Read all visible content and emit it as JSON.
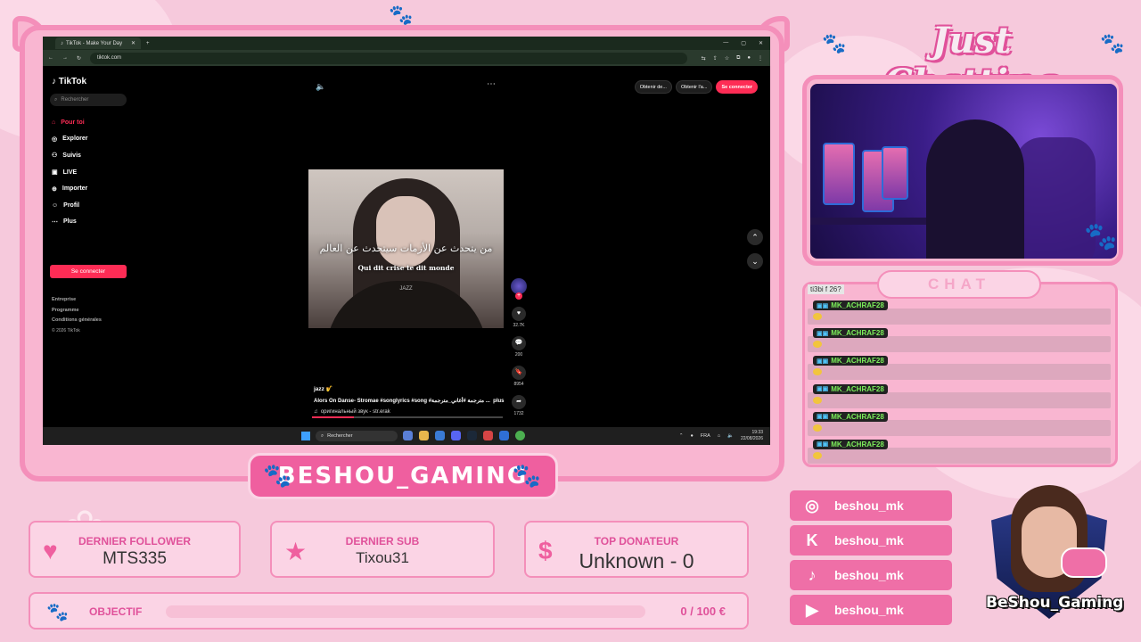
{
  "browser": {
    "tab_title": "TikTok - Make Your Day",
    "url": "tiktok.com"
  },
  "tiktok": {
    "logo": "TikTok",
    "search_placeholder": "Rechercher",
    "nav": [
      {
        "icon": "home-icon",
        "label": "Pour toi"
      },
      {
        "icon": "compass-icon",
        "label": "Explorer"
      },
      {
        "icon": "following-icon",
        "label": "Suivis"
      },
      {
        "icon": "live-icon",
        "label": "LIVE"
      },
      {
        "icon": "upload-icon",
        "label": "Importer"
      },
      {
        "icon": "profile-icon",
        "label": "Profil"
      },
      {
        "icon": "more-icon",
        "label": "Plus"
      }
    ],
    "connect_label": "Se connecter",
    "footer": [
      "Entreprise",
      "Programme",
      "Conditions générales"
    ],
    "copyright": "© 2026 TikTok",
    "top_buttons": [
      "Obtenir de...",
      "Obtenir l'a..."
    ],
    "top_connect": "Se connecter",
    "video": {
      "subtitle_arabic": "من يتحدث عن الأزمات سيتحدث عن العالم",
      "subtitle_french": "Qui dit crise te dit monde",
      "watermark": "JAZZ",
      "likes": "32.7K",
      "comments": "200",
      "saves": "8954",
      "shares": "1732",
      "username": "jazz 🎷",
      "description": "Alors On Danse- Stromae #songlyrics #song #مترجمة #أغاني_مترجمة ...",
      "more": "plus",
      "sound": "оригинальный звук - str.erak"
    }
  },
  "taskbar": {
    "search": "Rechercher",
    "lang": "FRA",
    "time": "19:33",
    "date": "22/08/2026"
  },
  "overlay": {
    "title": "Just Chatting",
    "chat_title": "CHAT",
    "chat_first": "ti3bi f 26?",
    "chat_messages": [
      {
        "user": "MK_ACHRAF28"
      },
      {
        "user": "MK_ACHRAF28"
      },
      {
        "user": "MK_ACHRAF28"
      },
      {
        "user": "MK_ACHRAF28"
      },
      {
        "user": "MK_ACHRAF28"
      },
      {
        "user": "MK_ACHRAF28"
      }
    ],
    "channel_name": "BESHOU_GAMING",
    "socials": [
      {
        "icon": "instagram-icon",
        "handle": "beshou_mk"
      },
      {
        "icon": "kick-icon",
        "handle": "beshou_mk"
      },
      {
        "icon": "tiktok-icon",
        "handle": "beshou_mk"
      },
      {
        "icon": "youtube-icon",
        "handle": "beshou_mk"
      }
    ],
    "avatar_name": "BeShou_Gaming",
    "stats": {
      "follower_label": "DERNIER FOLLOWER",
      "follower_value": "MTS335",
      "sub_label": "DERNIER SUB",
      "sub_value": "Tixou31",
      "donor_label": "TOP DONATEUR",
      "donor_value": "Unknown - 0"
    },
    "goal": {
      "label": "OBJECTIF",
      "amount": "0 / 100 €",
      "progress": 0
    }
  },
  "colors": {
    "accent_pink": "#ef5f9f",
    "tiktok_red": "#fe2c55",
    "chat_user_green": "#7cf05b"
  }
}
